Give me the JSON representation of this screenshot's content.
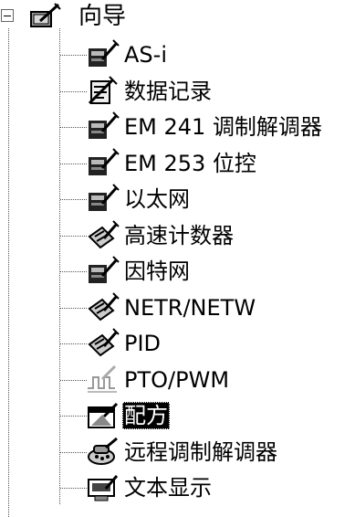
{
  "tree": {
    "root": {
      "label": "向导",
      "icon": "wizard-wand-icon"
    },
    "items": [
      {
        "label": "AS-i",
        "icon": "module-icon"
      },
      {
        "label": "数据记录",
        "icon": "data-log-icon"
      },
      {
        "label": "EM 241 调制解调器",
        "icon": "module-icon"
      },
      {
        "label": "EM 253 位控",
        "icon": "module-icon"
      },
      {
        "label": "以太网",
        "icon": "module-icon"
      },
      {
        "label": "高速计数器",
        "icon": "wand-doc-icon"
      },
      {
        "label": "因特网",
        "icon": "module-icon"
      },
      {
        "label": "NETR/NETW",
        "icon": "wand-doc-icon"
      },
      {
        "label": "PID",
        "icon": "wand-doc-icon"
      },
      {
        "label": "PTO/PWM",
        "icon": "pulse-train-icon"
      },
      {
        "label": "配方",
        "icon": "recipe-icon",
        "selected": true
      },
      {
        "label": "远程调制解调器",
        "icon": "remote-modem-icon"
      },
      {
        "label": "文本显示",
        "icon": "text-display-icon"
      }
    ]
  }
}
